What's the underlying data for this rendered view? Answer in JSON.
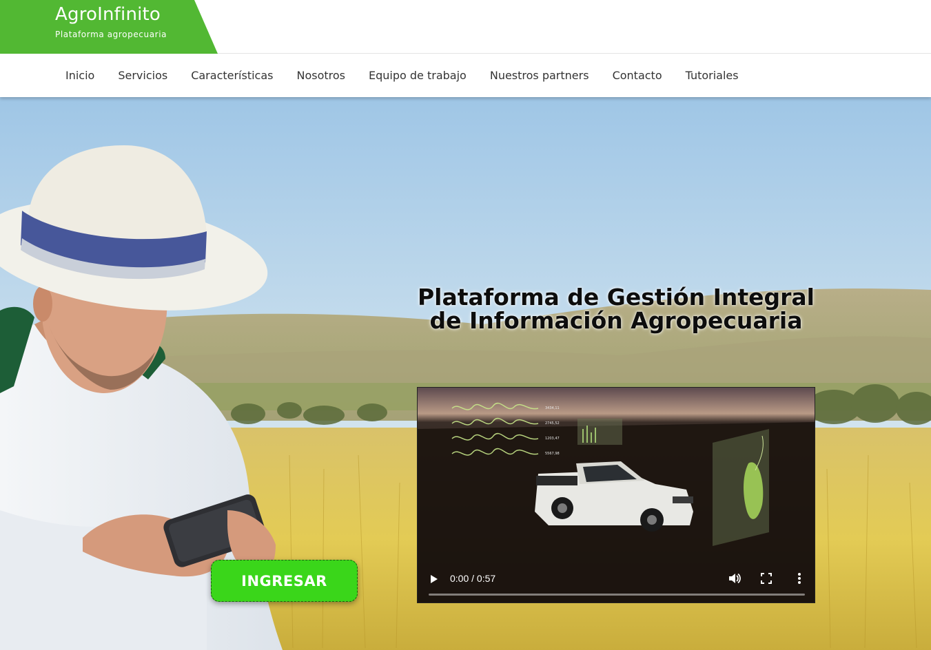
{
  "brand": {
    "title": "AgroInfinito",
    "subtitle": "Plataforma agropecuaria",
    "color": "#52b833"
  },
  "nav": {
    "items": [
      {
        "label": "Inicio"
      },
      {
        "label": "Servicios"
      },
      {
        "label": "Características"
      },
      {
        "label": "Nosotros"
      },
      {
        "label": "Equipo de trabajo"
      },
      {
        "label": "Nuestros partners"
      },
      {
        "label": "Contacto"
      },
      {
        "label": "Tutoriales"
      }
    ]
  },
  "hero": {
    "title": "Plataforma de Gestión Integral de Información Agropecuaria",
    "cta_label": "INGRESAR",
    "cta_color": "#3ad61a"
  },
  "video": {
    "time": "0:00 / 0:57",
    "progress": 0,
    "icons": [
      "play-icon",
      "volume-icon",
      "fullscreen-icon",
      "more-vert-icon"
    ]
  }
}
